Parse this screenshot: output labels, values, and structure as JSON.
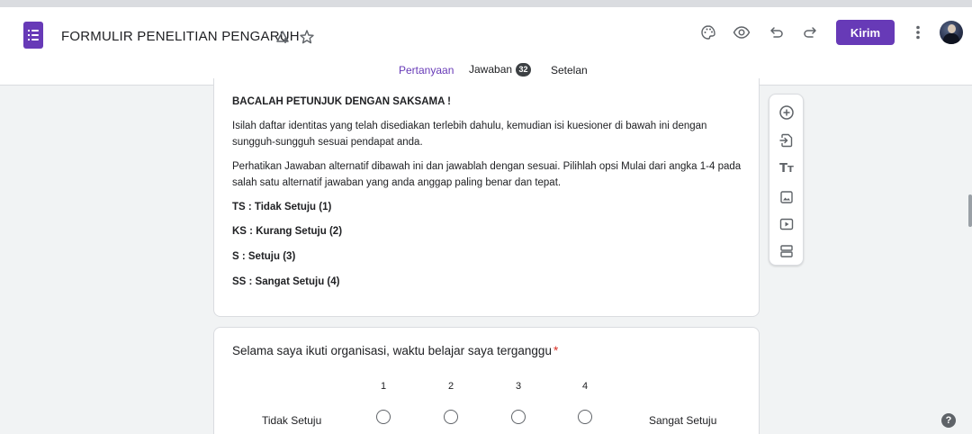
{
  "app": {
    "title": "FORMULIR PENELITIAN PENGARUH",
    "icons": [
      "forms-icon",
      "move-to-folder-icon",
      "star-icon",
      "palette-icon",
      "preview-eye-icon",
      "undo-icon",
      "redo-icon",
      "more-vert-icon",
      "avatar"
    ],
    "send_label": "Kirim",
    "brand_color": "#673ab7"
  },
  "tabs": [
    {
      "label": "Pertanyaan",
      "active": true
    },
    {
      "label": "Jawaban",
      "count": "32"
    },
    {
      "label": "Setelan"
    }
  ],
  "instructions": {
    "heading": "BACALAH PETUNJUK DENGAN SAKSAMA !",
    "para1": "Isilah daftar identitas yang telah disediakan terlebih dahulu, kemudian isi kuesioner di bawah ini dengan sungguh-sungguh sesuai pendapat anda.",
    "para2": "Perhatikan Jawaban alternatif dibawah ini dan jawablah dengan sesuai. Pilihlah opsi Mulai dari angka 1-4 pada salah satu alternatif jawaban yang anda anggap paling benar dan tepat.",
    "scale_items": [
      "TS  :  Tidak Setuju (1)",
      "KS  : Kurang Setuju (2)",
      "S  : Setuju (3)",
      "SS : Sangat Setuju (4)"
    ]
  },
  "question": {
    "title": "Selama saya ikuti organisasi, waktu belajar saya terganggu",
    "required_mark": "*",
    "scale_numbers": [
      "1",
      "2",
      "3",
      "4"
    ],
    "low_label": "Tidak Setuju",
    "high_label": "Sangat Setuju"
  },
  "side_toolbar": [
    "add-question-icon",
    "import-questions-icon",
    "add-title-icon",
    "add-image-icon",
    "add-video-icon",
    "add-section-icon"
  ],
  "help_label": "?"
}
